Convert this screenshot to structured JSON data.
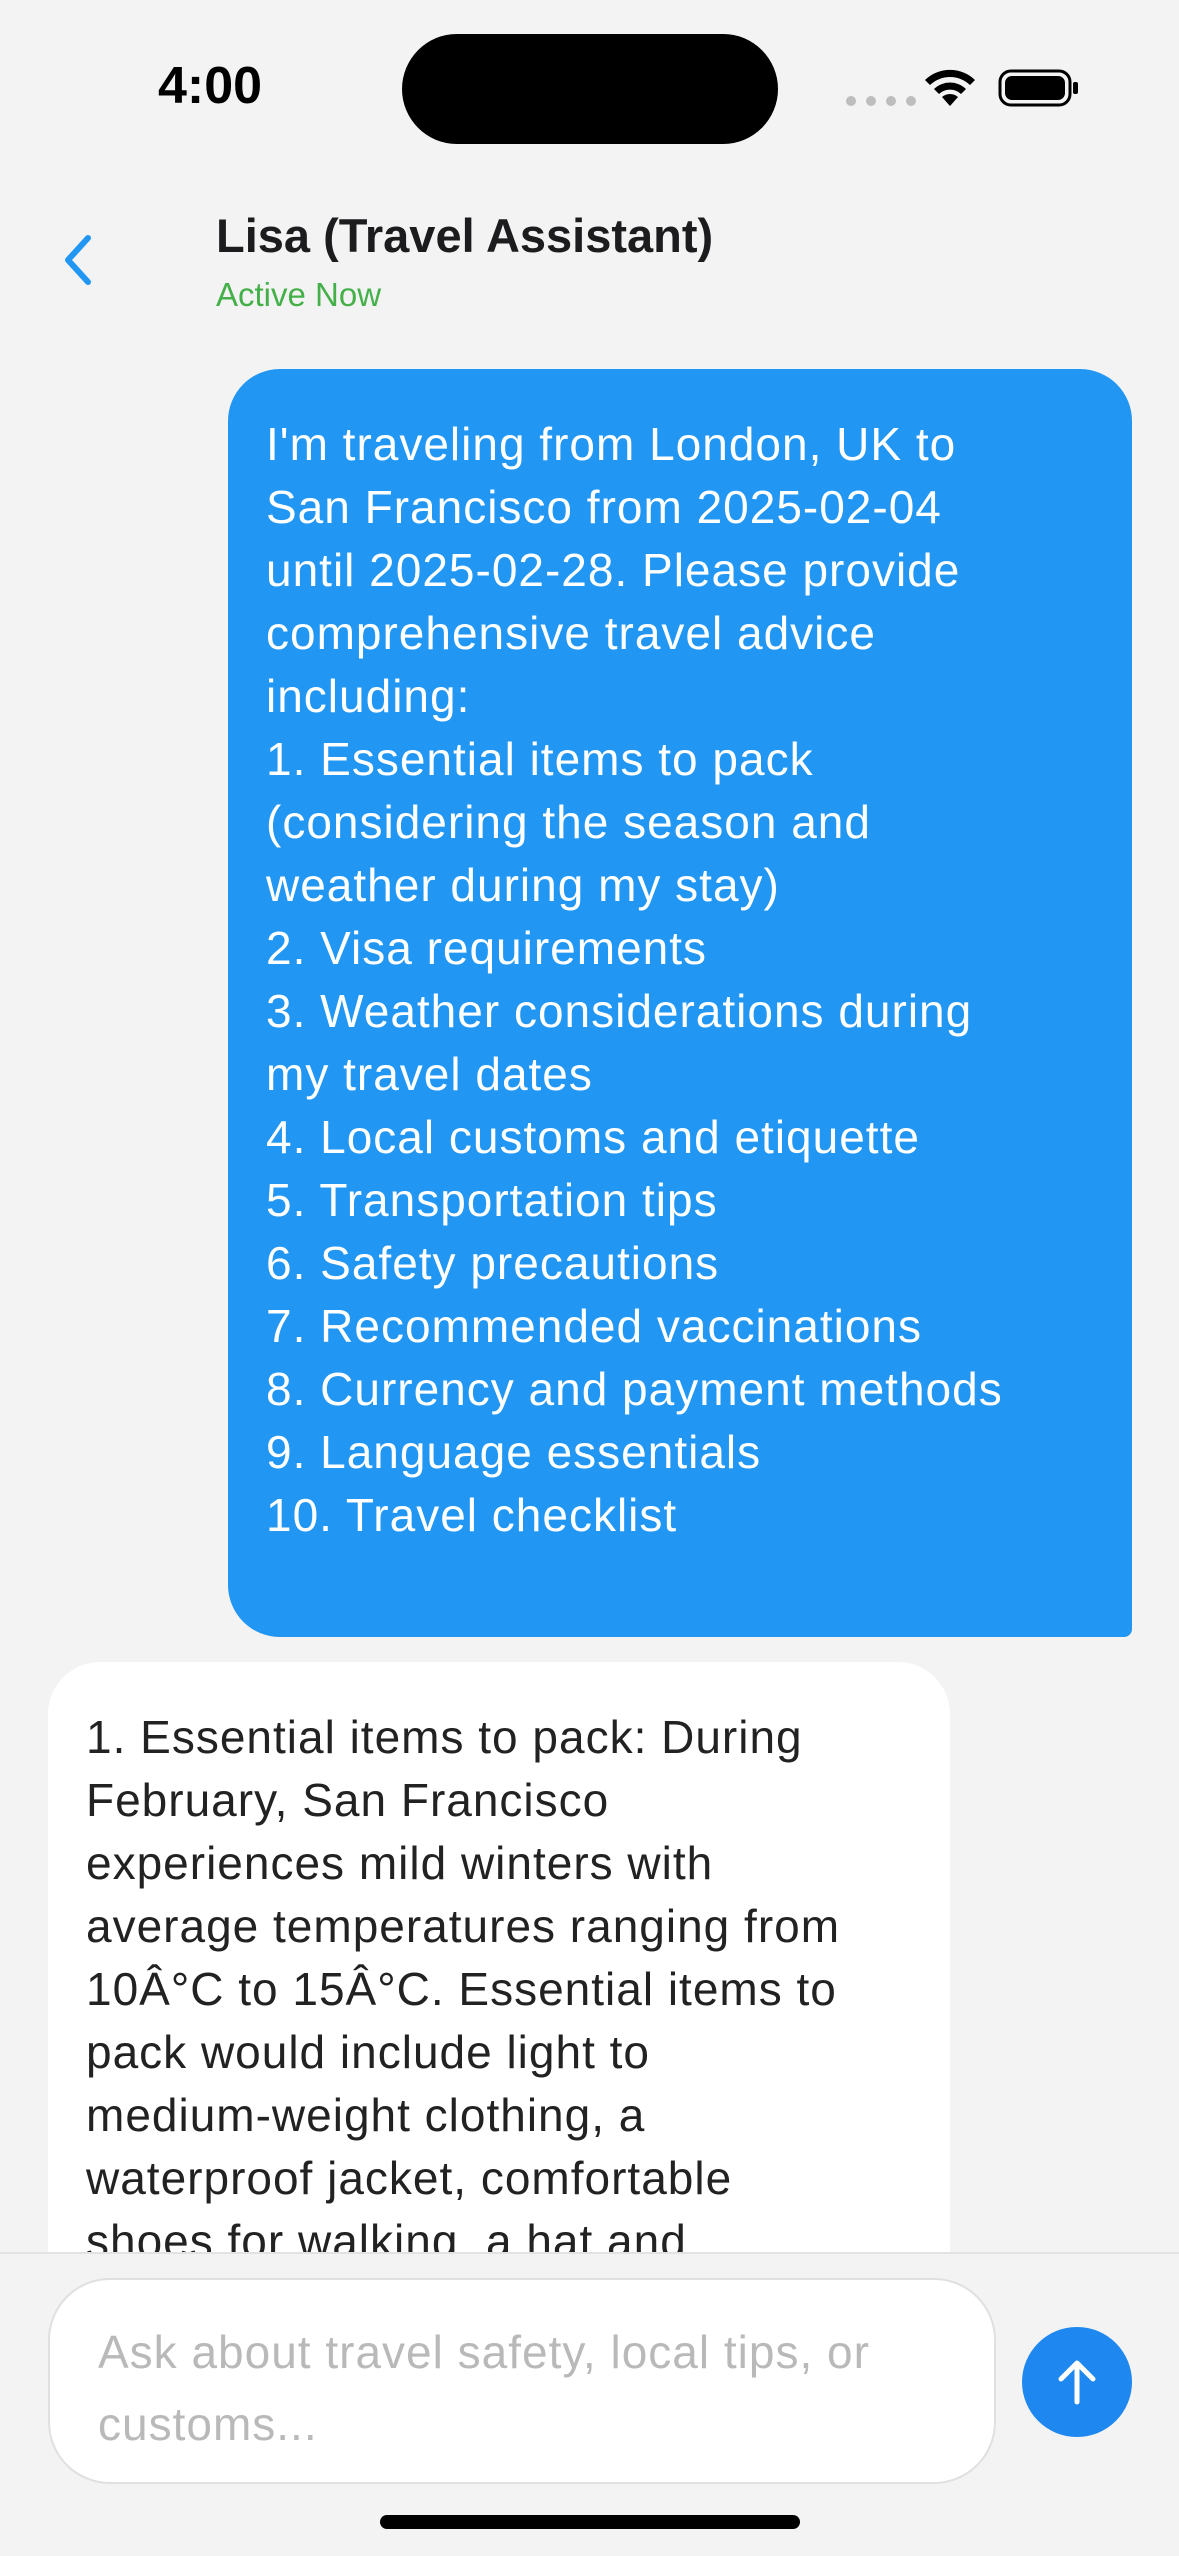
{
  "status_bar": {
    "time": "4:00",
    "icons": [
      "cellular-signal-icon",
      "wifi-icon",
      "battery-icon"
    ]
  },
  "header": {
    "back_icon": "chevron-left-icon",
    "contact_name": "Lisa (Travel Assistant)",
    "status": "Active Now"
  },
  "messages": [
    {
      "role": "user",
      "text": "I'm traveling from London, UK to\nSan Francisco from 2025-02-04\nuntil 2025-02-28. Please provide\ncomprehensive travel advice\nincluding:\n1. Essential items to pack\n(considering the season and\nweather during my stay)\n2. Visa requirements\n3. Weather considerations during\nmy travel dates\n4. Local customs and etiquette\n5. Transportation tips\n6. Safety precautions\n7. Recommended vaccinations\n8. Currency and payment methods\n9. Language essentials\n10. Travel checklist"
    },
    {
      "role": "assistant",
      "text": "1. Essential items to pack: During\nFebruary, San Francisco\nexperiences mild winters with\naverage temperatures ranging from\n10Â°C to 15Â°C. Essential items to\npack would include light to\nmedium-weight clothing, a\nwaterproof jacket, comfortable\nshoes for walking, a hat and"
    }
  ],
  "composer": {
    "placeholder": "Ask about travel safety, local tips, or customs...",
    "value": "",
    "send_icon": "arrow-up-icon"
  },
  "colors": {
    "accent": "#2196f3",
    "status_active": "#45b04a",
    "background": "#f3f3f3",
    "assistant_bubble": "#ffffff"
  }
}
